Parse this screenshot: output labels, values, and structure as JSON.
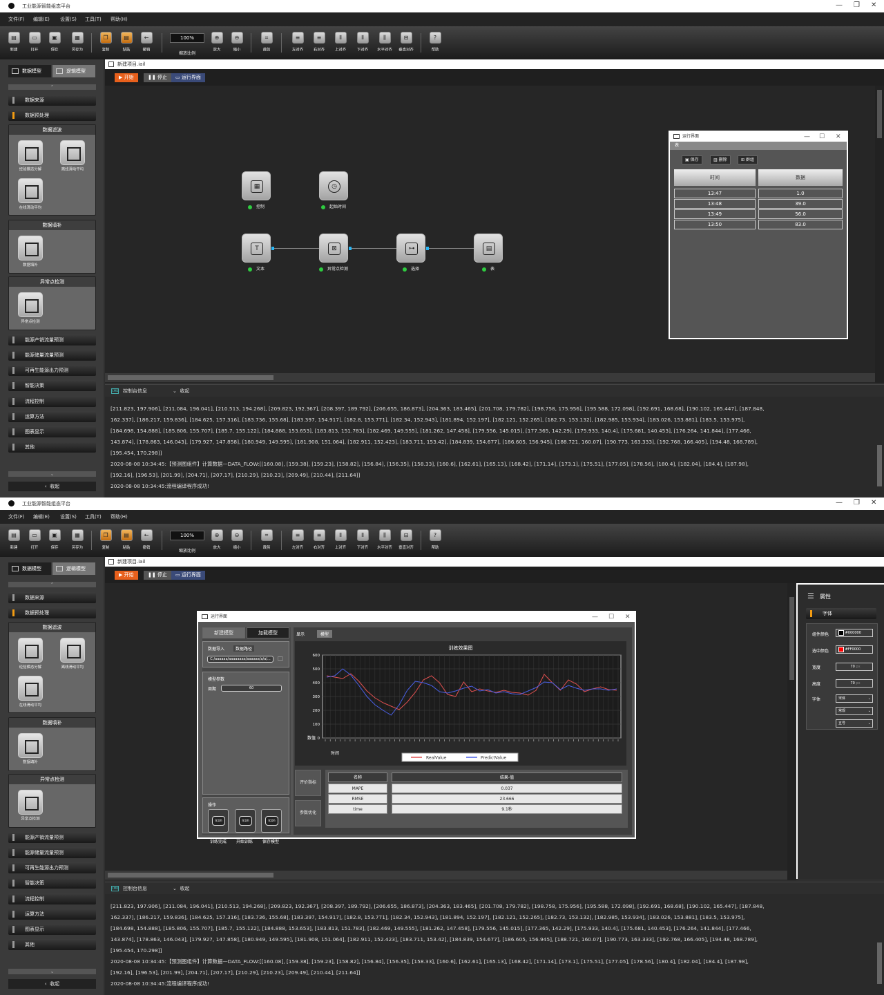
{
  "app": {
    "title": "工业能源智能组态平台",
    "menu": [
      "文件(F)",
      "编辑(E)",
      "设置(S)",
      "工具(T)",
      "帮助(H)"
    ],
    "toolbar": {
      "new": "新建",
      "open": "打开",
      "save": "保存",
      "save_as": "另存为",
      "copy": "复制",
      "paste": "粘贴",
      "undo": "撤销",
      "zoom_value": "100%",
      "zoom_label": "缩放比例",
      "zoom_in": "放大",
      "zoom_out": "缩小",
      "crop": "裁剪",
      "align_left": "左对齐",
      "align_right": "右对齐",
      "align_top": "上对齐",
      "align_bottom": "下对齐",
      "align_hcenter": "水平对齐",
      "align_vcenter": "垂直对齐",
      "help": "帮助"
    }
  },
  "sidebar": {
    "tab_data": "数据模型",
    "tab_logic": "逻辑模型",
    "source": "数据来源",
    "preprocess": "数据预处理",
    "group_filter": {
      "title": "数据滤波",
      "items": [
        "经验模态分解",
        "离线滑动平均",
        "在线滑动平均"
      ]
    },
    "group_fill": {
      "title": "数据填补",
      "items": [
        "数据填补"
      ]
    },
    "group_outlier": {
      "title": "异常点检测",
      "items": [
        "异常点检测"
      ]
    },
    "items": [
      "能源产销流量预测",
      "能源储量流量预测",
      "可再生能源出力预测",
      "智能决策",
      "流程控制",
      "运算方法",
      "图表显示",
      "其他"
    ],
    "collapse": "收起"
  },
  "editor": {
    "file_tab": "新建项目.iail",
    "start": "开始",
    "stop": "停止",
    "run_ui": "运行界面"
  },
  "flow_nodes": {
    "control": "控制",
    "start_time": "起始时间",
    "text": "文本",
    "outlier": "异常点检测",
    "select": "选择",
    "table": "表"
  },
  "run_window_1": {
    "title": "运行界面",
    "sub": "表",
    "save": "保存",
    "delete": "删除",
    "group": "群组",
    "col_time": "时间",
    "col_data": "数据",
    "rows": [
      [
        "13:47",
        "1.0"
      ],
      [
        "13:48",
        "39.0"
      ],
      [
        "13:49",
        "56.0"
      ],
      [
        "13:50",
        "83.0"
      ]
    ]
  },
  "console": {
    "title": "控制台信息",
    "collapse": "收起",
    "lines": [
      "[211.823, 197.906], [211.084, 196.041], [210.513, 194.268], [209.823, 192.367], [208.397, 189.792], [206.655, 186.873], [204.363, 183.465], [201.708, 179.782], [198.758, 175.956], [195.588, 172.098], [192.691, 168.68], [190.102, 165.447], [187.848,",
      "162.337], [186.217, 159.836], [184.625, 157.316], [183.736, 155.68], [183.397, 154.917], [182.8, 153.771], [182.34, 152.943], [181.894, 152.197], [182.121, 152.265], [182.73, 153.132], [182.985, 153.934], [183.026, 153.881], [183.5, 153.975],",
      "[184.698, 154.888], [185.806, 155.707], [185.7, 155.122], [184.888, 153.653], [183.813, 151.783], [182.469, 149.555], [181.262, 147.458], [179.556, 145.015], [177.365, 142.29], [175.933, 140.4], [175.681, 140.453], [176.264, 141.844], [177.466,",
      "143.874], [178.863, 146.043], [179.927, 147.858], [180.949, 149.595], [181.908, 151.064], [182.911, 152.423], [183.711, 153.42], [184.839, 154.677], [186.605, 156.945], [188.721, 160.07], [190.773, 163.333], [192.768, 166.405], [194.48, 168.789],",
      "[195.454, 170.298]]",
      "2020-08-08 10:34:45:【预测图组件】计算数据—DATA_FLOW:[[160.08], [159.38], [159.23], [158.82], [156.84], [156.35], [158.33], [160.6], [162.61], [165.13], [168.42], [171.14], [173.1], [175.51], [177.05], [178.56], [180.4], [182.04], [184.4], [187.98],",
      "[192.16], [196.53], [201.99], [204.71], [207.17], [210.29], [210.23], [209.49], [210.44], [211.64]]",
      "2020-08-08 10:34:45:流程编译程序成功!"
    ]
  },
  "run_window_2": {
    "title": "运行界面",
    "tab_new_model": "新建模型",
    "tab_load_model": "加载模型",
    "data_import": "数据导入",
    "data_path": "数据路径",
    "path_value": "C:/aaaaaa/aaaaaaaa/aaaaaa/a/a/...",
    "model_params": "模型参数",
    "period_label": "周期",
    "period_value": "60",
    "ops_title": "操作",
    "op_done": "训练完成",
    "op_train": "开始训练",
    "op_save": "保存模型",
    "icon_text": "icon",
    "view_display": "显示",
    "view_model": "模型",
    "eval_btn": "评价指标",
    "param_opt_btn": "参数优化",
    "metrics_headers": [
      "名称",
      "结果-值"
    ],
    "metrics": [
      [
        "MAPE",
        "0.037"
      ],
      [
        "RMSE",
        "23.666"
      ],
      [
        "time",
        "9.1秒"
      ]
    ]
  },
  "chart_data": {
    "type": "line",
    "title": "训练效果图",
    "xlabel": "时间",
    "ylabel": "数值",
    "ylim": [
      0,
      600
    ],
    "yticks": [
      0,
      100,
      200,
      300,
      400,
      500,
      600
    ],
    "grid": true,
    "legend": "bottom",
    "colors": {
      "real": "#e05050",
      "predict": "#4a60e8"
    },
    "series": [
      {
        "name": "RealValue",
        "values": [
          450,
          440,
          430,
          465,
          410,
          340,
          290,
          255,
          230,
          205,
          260,
          330,
          420,
          450,
          400,
          315,
          300,
          405,
          335,
          355,
          340,
          330,
          345,
          330,
          325,
          310,
          345,
          460,
          400,
          345,
          420,
          390,
          335,
          355,
          370,
          350,
          345
        ]
      },
      {
        "name": "PredictValue",
        "values": [
          440,
          450,
          500,
          455,
          380,
          300,
          240,
          200,
          165,
          240,
          345,
          410,
          400,
          380,
          335,
          325,
          340,
          360,
          375,
          340,
          350,
          325,
          335,
          320,
          315,
          340,
          365,
          405,
          400,
          350,
          380,
          360,
          345,
          355,
          355,
          345,
          355
        ]
      }
    ]
  },
  "properties": {
    "title": "属性",
    "section": "字体",
    "comp_color_label": "组件颜色",
    "comp_color_value": "#000000",
    "sel_color_label": "选中颜色",
    "sel_color_value": "#FF0000",
    "width_label": "宽度",
    "width_value": "70",
    "height_label": "高度",
    "height_value": "70",
    "unit": "px",
    "font_label": "字体",
    "font_family": "宋体",
    "font_style": "常规",
    "font_size": "五号"
  }
}
